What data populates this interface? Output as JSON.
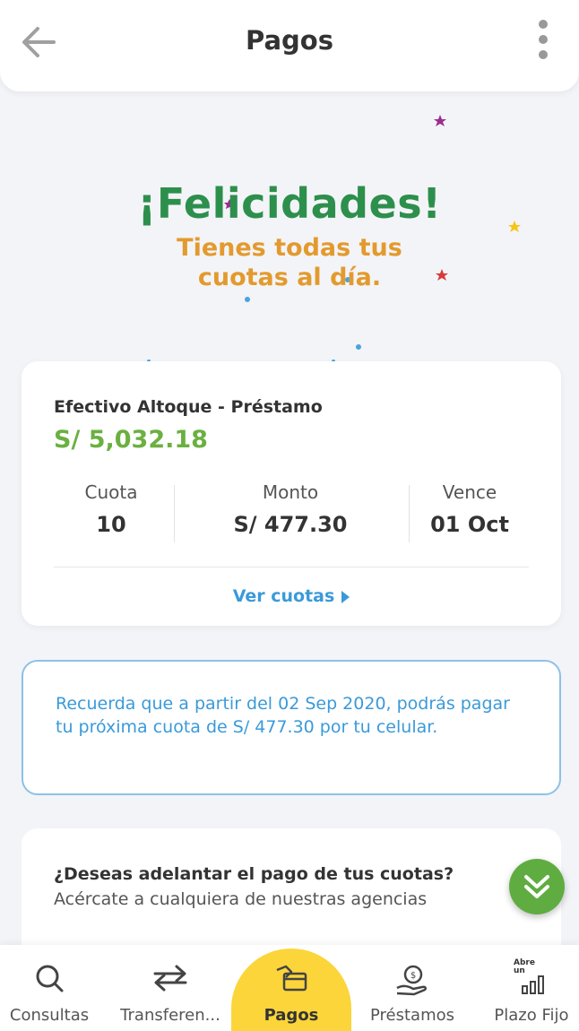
{
  "header": {
    "title": "Pagos"
  },
  "celebration": {
    "title": "¡Felicidades!",
    "line1": "Tienes todas tus",
    "line2": "cuotas al día."
  },
  "loan": {
    "name": "Efectivo Altoque - Préstamo",
    "amount": "S/ 5,032.18",
    "stats": [
      {
        "label": "Cuota",
        "value": "10"
      },
      {
        "label": "Monto",
        "value": "S/ 477.30"
      },
      {
        "label": "Vence",
        "value": "01 Oct"
      }
    ],
    "link_label": "Ver cuotas"
  },
  "info": {
    "text": "Recuerda que a partir del 02 Sep 2020, podrás pagar tu próxima cuota de  S/ 477.30 por tu celular."
  },
  "advance": {
    "question": "¿Deseas adelantar el pago de tus cuotas?",
    "subtitle": "Acércate a cualquiera de nuestras agencias"
  },
  "nav": {
    "items": [
      {
        "label": "Consultas",
        "icon": "search-icon"
      },
      {
        "label": "Transferen...",
        "icon": "transfer-icon"
      },
      {
        "label": "Pagos",
        "icon": "payment-icon",
        "active": true
      },
      {
        "label": "Préstamos",
        "icon": "loan-icon"
      },
      {
        "label": "Plazo Fijo",
        "icon": "fixed-term-icon",
        "badge": "Abre un"
      }
    ]
  },
  "colors": {
    "green": "#2d8f4c",
    "orange": "#e39a2d",
    "amount_green": "#6bb040",
    "link_blue": "#3a9ad9",
    "active_nav": "#fbd53a",
    "fab_green": "#5fad40"
  }
}
